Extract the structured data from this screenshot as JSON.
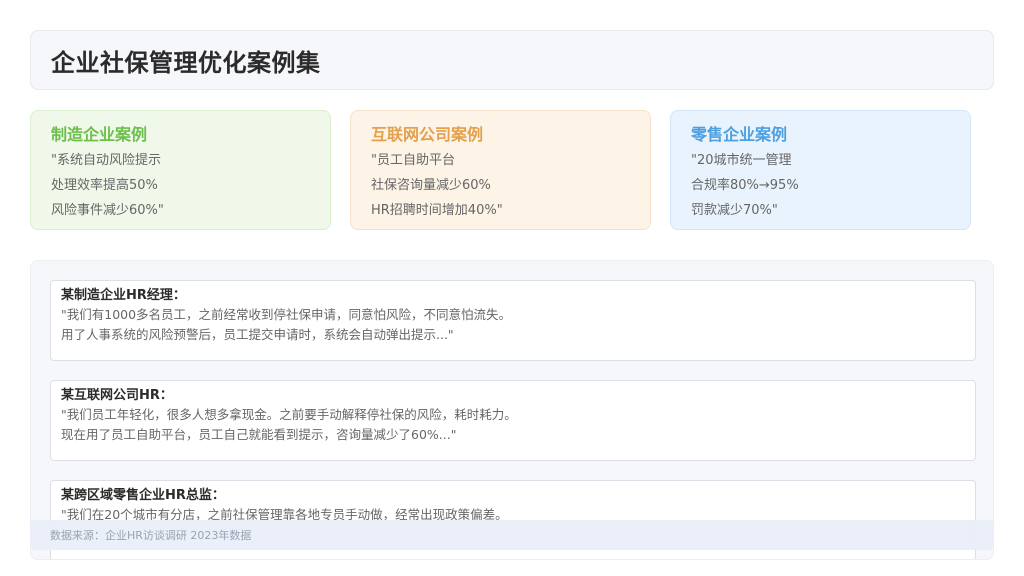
{
  "title": "企业社保管理优化案例集",
  "cards": [
    {
      "title": "制造企业案例",
      "lines": [
        "\"系统自动风险提示",
        "处理效率提高50%",
        "风险事件减少60%\""
      ],
      "accent": "#6cbf4b"
    },
    {
      "title": "互联网公司案例",
      "lines": [
        "\"员工自助平台",
        "社保咨询量减少60%",
        "HR招聘时间增加40%\""
      ],
      "accent": "#e4a04c"
    },
    {
      "title": "零售企业案例",
      "lines": [
        "\"20城市统一管理",
        "合规率80%→95%",
        "罚款减少70%\""
      ],
      "accent": "#4d9fe0"
    }
  ],
  "quotes": [
    {
      "author": "某制造企业HR经理：",
      "lines": [
        "\"我们有1000多名员工，之前经常收到停社保申请，同意怕风险，不同意怕流失。",
        "用了人事系统的风险预警后，员工提交申请时，系统会自动弹出提示...\""
      ]
    },
    {
      "author": "某互联网公司HR：",
      "lines": [
        "\"我们员工年轻化，很多人想多拿现金。之前要手动解释停社保的风险，耗时耗力。",
        "现在用了员工自助平台，员工自己就能看到提示，咨询量减少了60%...\""
      ]
    },
    {
      "author": "某跨区域零售企业HR总监：",
      "lines": [
        "\"我们在20个城市有分店，之前社保管理靠各地专员手动做，经常出现政策偏差。",
        ""
      ]
    }
  ],
  "footer": "数据来源：企业HR访谈调研 2023年数据"
}
